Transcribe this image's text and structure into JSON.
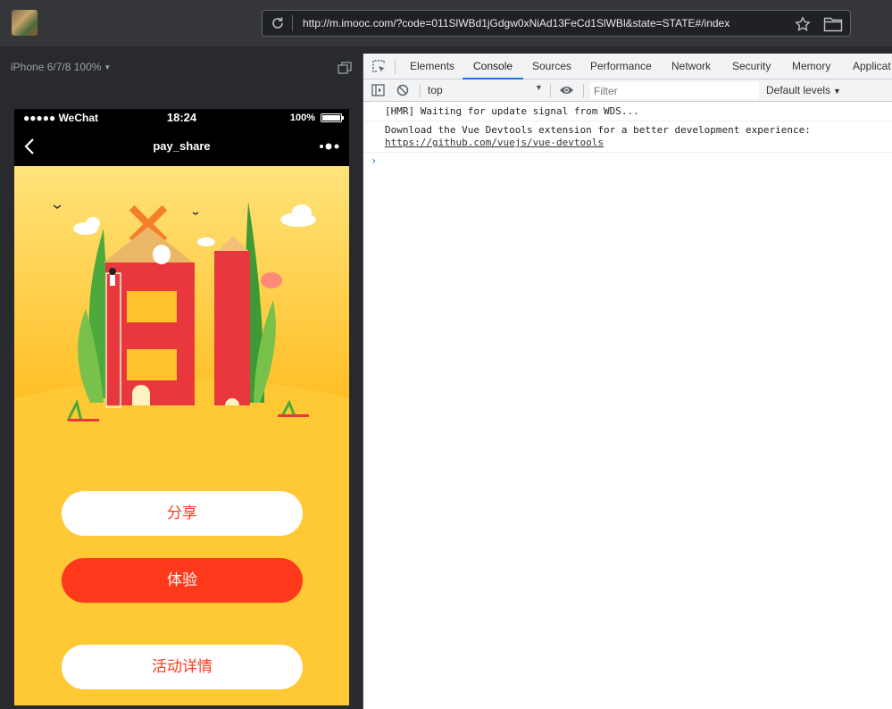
{
  "browser": {
    "url": "http://m.imooc.com/?code=011SlWBd1jGdgw0xNiAd13FeCd1SlWBl&state=STATE#/index"
  },
  "device_toolbar": {
    "device_label": "iPhone 6/7/8 100%"
  },
  "phone": {
    "status_bar": {
      "carrier": "●●●●● WeChat",
      "time": "18:24",
      "battery": "100%"
    },
    "nav_bar": {
      "title": "pay_share"
    },
    "buttons": {
      "share": "分享",
      "try": "体验",
      "detail": "活动详情"
    },
    "colors": {
      "background": "#ffc936",
      "accent": "#ff3a1c"
    }
  },
  "devtools": {
    "tabs": [
      "Elements",
      "Console",
      "Sources",
      "Performance",
      "Network",
      "Security",
      "Memory",
      "Applicat"
    ],
    "active_tab": "Console",
    "console_bar": {
      "context": "top",
      "filter_placeholder": "Filter",
      "levels": "Default levels"
    },
    "logs": [
      {
        "text": "[HMR] Waiting for update signal from WDS..."
      },
      {
        "text": "Download the Vue Devtools extension for a better development experience:",
        "link": "https://github.com/vuejs/vue-devtools"
      }
    ]
  }
}
